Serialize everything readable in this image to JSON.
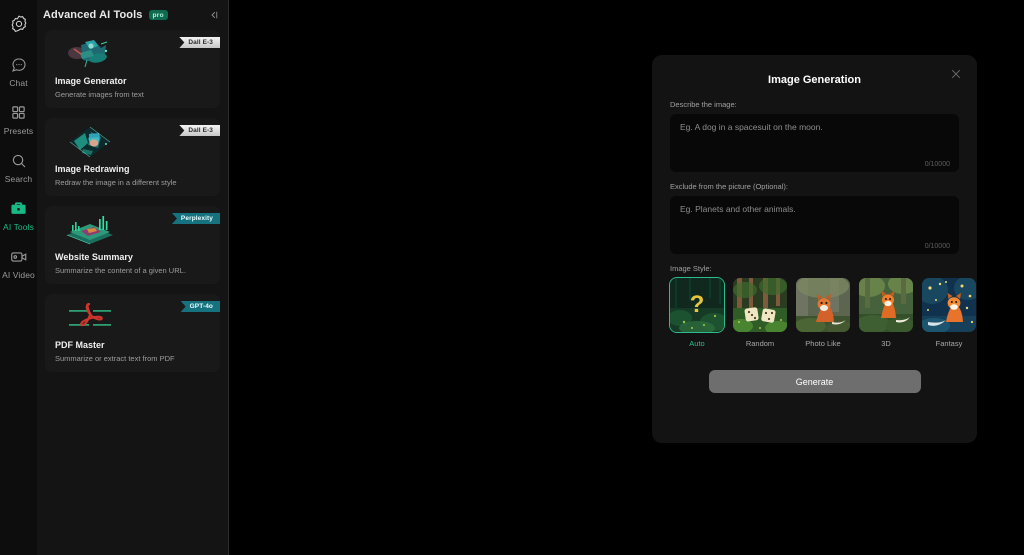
{
  "rail": {
    "logo_icon": "settings-gear-icon",
    "items": [
      {
        "label": "Chat",
        "icon": "chat-bubble-icon",
        "active": false
      },
      {
        "label": "Presets",
        "icon": "grid-squares-icon",
        "active": false
      },
      {
        "label": "Search",
        "icon": "magnifier-icon",
        "active": false
      },
      {
        "label": "AI Tools",
        "icon": "briefcase-icon",
        "active": true
      },
      {
        "label": "AI Video",
        "icon": "video-camera-icon",
        "active": false
      }
    ],
    "active_color": "#18b884"
  },
  "panel": {
    "title": "Advanced AI Tools",
    "pro_badge": "pro",
    "collapse_icon": "collapse-left-icon",
    "cards": [
      {
        "name": "Image Generator",
        "desc": "Generate images from text",
        "badge": "Dall E-3",
        "badge_style": "light",
        "thumb": "image-generator-thumbnail"
      },
      {
        "name": "Image Redrawing",
        "desc": "Redraw the image in a different style",
        "badge": "Dall E-3",
        "badge_style": "light",
        "thumb": "image-redrawing-thumbnail"
      },
      {
        "name": "Website Summary",
        "desc": "Summarize the content of a given URL.",
        "badge": "Perplexity",
        "badge_style": "teal",
        "thumb": "website-summary-thumbnail"
      },
      {
        "name": "PDF Master",
        "desc": "Summarize or extract text from PDF",
        "badge": "GPT-4o",
        "badge_style": "teal",
        "thumb": "pdf-master-thumbnail"
      }
    ]
  },
  "modal": {
    "title": "Image Generation",
    "close_icon": "close-x-icon",
    "describe": {
      "label": "Describe the image:",
      "placeholder": "Eg. A dog in a spacesuit on the moon.",
      "value": "",
      "counter": "0/10000"
    },
    "exclude": {
      "label": "Exclude from the picture (Optional):",
      "placeholder": "Eg. Planets and other animals.",
      "value": "",
      "counter": "0/10000"
    },
    "style": {
      "label": "Image Style:",
      "options": [
        {
          "name": "Auto",
          "selected": true
        },
        {
          "name": "Random",
          "selected": false
        },
        {
          "name": "Photo Like",
          "selected": false
        },
        {
          "name": "3D",
          "selected": false
        },
        {
          "name": "Fantasy",
          "selected": false
        }
      ],
      "selected_color": "#2bbd8f"
    },
    "generate_label": "Generate"
  }
}
